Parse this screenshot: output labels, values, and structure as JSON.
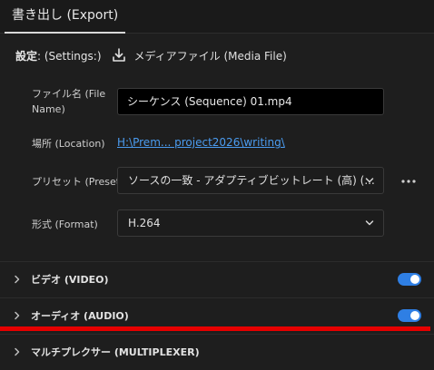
{
  "tabs": [
    {
      "label": "書き出し (Export)"
    }
  ],
  "settings": {
    "label": "設定",
    "label_sub": ": (Settings:)",
    "icon": "download-icon",
    "media_file": "メディアファイル (Media File)"
  },
  "form": {
    "filename": {
      "label_line1": "ファイル名 (File",
      "label_line2": "Name)",
      "value": "シーケンス (Sequence) 01.mp4"
    },
    "location": {
      "label": "場所 (Location)",
      "value": "H:\\Prem... project2026\\writing\\"
    },
    "preset": {
      "label": "プリセット (Preset)",
      "value": "ソースの一致 - アダプティブビットレート (高) (..."
    },
    "format": {
      "label": "形式 (Format)",
      "value": "H.264"
    }
  },
  "sections": [
    {
      "label": "ビデオ (VIDEO)",
      "enabled": true
    },
    {
      "label": "オーディオ (AUDIO)",
      "enabled": true
    },
    {
      "label": "マルチプレクサー (MULTIPLEXER)"
    }
  ],
  "colors": {
    "accent": "#2f7fe4",
    "link": "#4b9cf0",
    "highlight": "#e60000",
    "background": "#1e1e1e"
  }
}
